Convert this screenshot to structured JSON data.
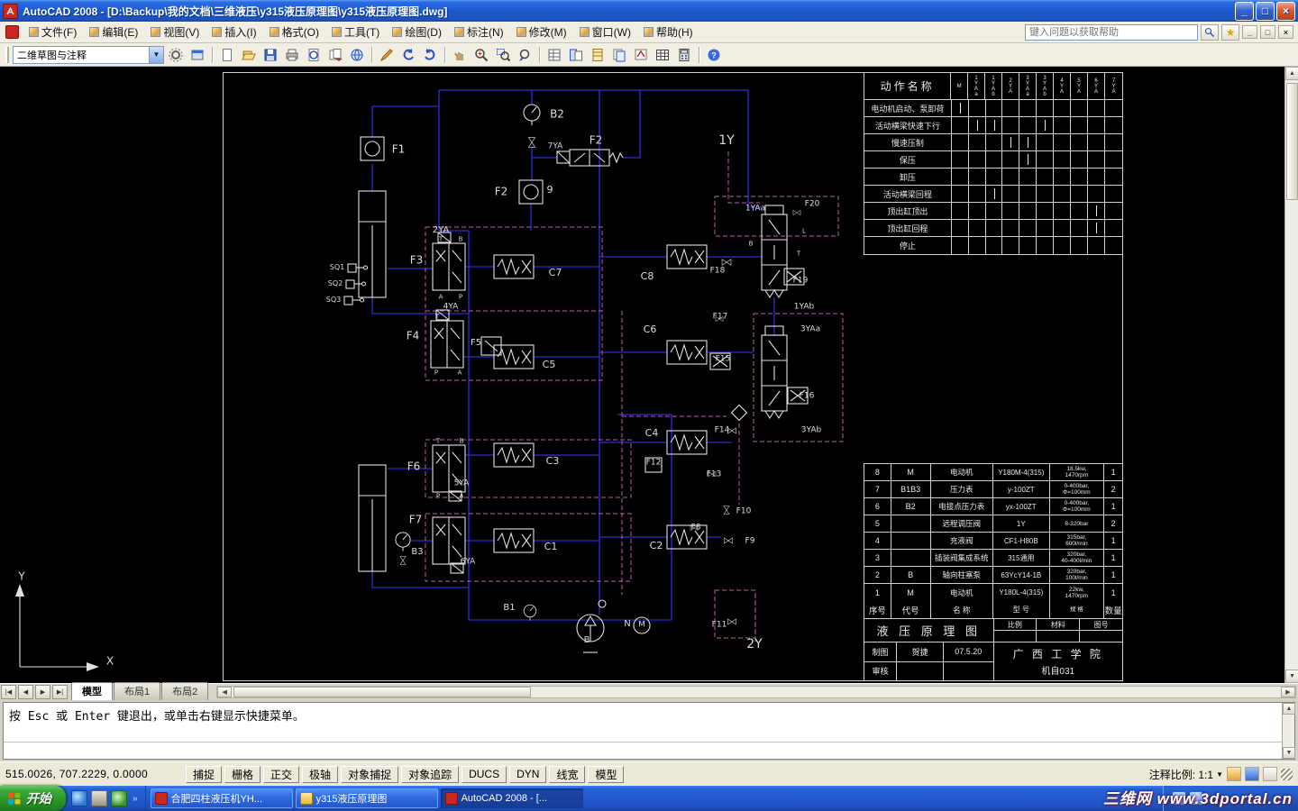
{
  "window": {
    "title": "AutoCAD 2008 - [D:\\Backup\\我的文档\\三维液压\\y315液压原理图\\y315液压原理图.dwg]"
  },
  "menu": {
    "items": [
      "文件(F)",
      "编辑(E)",
      "视图(V)",
      "插入(I)",
      "格式(O)",
      "工具(T)",
      "绘图(D)",
      "标注(N)",
      "修改(M)",
      "窗口(W)",
      "帮助(H)"
    ],
    "help_placeholder": "键入问题以获取帮助"
  },
  "toolbar": {
    "workspace": "二维草图与注释"
  },
  "command": {
    "message": "按 Esc 或 Enter 键退出，或单击右键显示快捷菜单。"
  },
  "status": {
    "coords": "515.0026, 707.2229, 0.0000",
    "toggles": [
      "捕捉",
      "栅格",
      "正交",
      "极轴",
      "对象捕捉",
      "对象追踪",
      "DUCS",
      "DYN",
      "线宽",
      "模型"
    ],
    "annotation_scale": "注释比例: 1:1"
  },
  "tabs": {
    "items": [
      "模型",
      "布局1",
      "布局2"
    ],
    "active": 0
  },
  "taskbar": {
    "start": "开始",
    "tasks": [
      {
        "label": "合肥四柱液压机YH...",
        "icon": "acad",
        "active": false
      },
      {
        "label": "y315液压原理图",
        "icon": "folder",
        "active": false
      },
      {
        "label": "AutoCAD 2008 - [...",
        "icon": "acad",
        "active": true
      }
    ],
    "watermark": "三维网 www.3dportal.cn"
  },
  "action_table": {
    "title": "动作名称",
    "motor_col": "M",
    "solenoid_cols": [
      "1YAa",
      "1YAb",
      "2YA",
      "3YAa",
      "3YAb",
      "4YA",
      "5YA",
      "6YA",
      "7YA"
    ],
    "rows": [
      "电动机启动、泵卸荷",
      "活动横梁快速下行",
      "慢速压制",
      "保压",
      "卸压",
      "活动横梁回程",
      "顶出缸顶出",
      "顶出缸回程",
      "停止"
    ],
    "marks": [
      [
        0,
        0
      ],
      [
        1,
        1
      ],
      [
        1,
        2
      ],
      [
        1,
        5
      ],
      [
        2,
        3
      ],
      [
        2,
        4
      ],
      [
        3,
        4
      ],
      [
        5,
        2
      ],
      [
        6,
        8
      ],
      [
        7,
        8
      ]
    ]
  },
  "bom": {
    "headers": [
      "序号",
      "代号",
      "名 称",
      "型 号",
      "规 格",
      "数量"
    ],
    "items": [
      {
        "seq": "8",
        "code": "M",
        "name": "电动机",
        "model": "Y180M-4(315)",
        "spec": "18.5kw,\n1470rpm",
        "qty": "1"
      },
      {
        "seq": "7",
        "code": "B1B3",
        "name": "压力表",
        "model": "y-100ZT",
        "spec": "0-400bar,\nΦ=100mm",
        "qty": "2"
      },
      {
        "seq": "6",
        "code": "B2",
        "name": "电接点压力表",
        "model": "yx-100ZT",
        "spec": "0-400bar,\nΦ=100mm",
        "qty": "1"
      },
      {
        "seq": "5",
        "code": "",
        "name": "远程调压阀",
        "model": "1Y",
        "spec": "8-320bar",
        "qty": "2"
      },
      {
        "seq": "4",
        "code": "",
        "name": "充液阀",
        "model": "CF1-H80B",
        "spec": "315bar,\n600l/min",
        "qty": "1"
      },
      {
        "seq": "3",
        "code": "",
        "name": "插装阀集成系统",
        "model": "315通用",
        "spec": "320bar,\n40-400l/min",
        "qty": "1"
      },
      {
        "seq": "2",
        "code": "B",
        "name": "轴向柱塞泵",
        "model": "63YcY14-1B",
        "spec": "320bar,\n100l/min",
        "qty": "1"
      },
      {
        "seq": "1",
        "code": "M",
        "name": "电动机",
        "model": "Y180L-4(315)",
        "spec": "22kw,\n1470rpm",
        "qty": "1"
      }
    ],
    "title": "液 压 原 理 图",
    "scale_label": "比例",
    "material_label": "材料",
    "figno_label": "图号",
    "drawn_label": "制图",
    "drawn_by": "贺捷",
    "date": "07.5.20",
    "org": "广 西 工 学 院",
    "checked_label": "审核",
    "class_no": "机自031"
  },
  "drawing": {
    "colors": {
      "main_lines": "#2e2ed6",
      "symbol_lines": "#e0e0e0",
      "pilot_lines": "#c05db0",
      "frame_lines": "#cccccc"
    },
    "labels": [
      [
        "B2",
        618,
        127,
        12
      ],
      [
        "F2",
        661,
        156,
        12
      ],
      [
        "7YA",
        616,
        163,
        9
      ],
      [
        "F1",
        442,
        166,
        12
      ],
      [
        "F2",
        556,
        213,
        12
      ],
      [
        "9",
        610,
        211,
        11
      ],
      [
        "1Y",
        806,
        157,
        14
      ],
      [
        "2YA",
        489,
        256,
        10
      ],
      [
        "F3",
        462,
        289,
        12
      ],
      [
        "SQ1",
        374,
        297,
        8
      ],
      [
        "SQ2",
        372,
        315,
        8
      ],
      [
        "SQ3",
        370,
        333,
        8
      ],
      [
        "C7",
        616,
        303,
        11
      ],
      [
        "C8",
        718,
        307,
        11
      ],
      [
        "F18",
        796,
        301,
        9
      ],
      [
        "F19",
        888,
        312,
        9
      ],
      [
        "F20",
        901,
        227,
        9
      ],
      [
        "1YAa",
        838,
        232,
        9
      ],
      [
        "1YAb",
        892,
        341,
        9
      ],
      [
        "4YA",
        500,
        341,
        9
      ],
      [
        "F4",
        458,
        373,
        12
      ],
      [
        "F5",
        528,
        381,
        10
      ],
      [
        "C5",
        609,
        405,
        11
      ],
      [
        "C6",
        721,
        366,
        11
      ],
      [
        "F17",
        799,
        352,
        9
      ],
      [
        "3YAa",
        899,
        366,
        9
      ],
      [
        "F15",
        802,
        399,
        9
      ],
      [
        "F16",
        895,
        440,
        9
      ],
      [
        "3YAb",
        900,
        478,
        9
      ],
      [
        "C4",
        723,
        481,
        11
      ],
      [
        "F14",
        801,
        478,
        9
      ],
      [
        "F6",
        459,
        518,
        12
      ],
      [
        "C3",
        613,
        512,
        11
      ],
      [
        "5YA",
        512,
        537,
        9
      ],
      [
        "F12",
        725,
        514,
        9
      ],
      [
        "F13",
        792,
        527,
        9
      ],
      [
        "F10",
        825,
        568,
        9
      ],
      [
        "F7",
        461,
        577,
        12
      ],
      [
        "B3",
        463,
        613,
        10
      ],
      [
        "6YA",
        519,
        624,
        9
      ],
      [
        "C1",
        611,
        607,
        11
      ],
      [
        "C2",
        728,
        606,
        11
      ],
      [
        "F9",
        832,
        601,
        9
      ],
      [
        "F8",
        772,
        586,
        9
      ],
      [
        "B1",
        565,
        675,
        10
      ],
      [
        "N",
        696,
        693,
        10
      ],
      [
        "M",
        712,
        694,
        9
      ],
      [
        "B",
        651,
        711,
        10
      ],
      [
        "F11",
        798,
        694,
        9
      ],
      [
        "2Y",
        837,
        716,
        14
      ],
      [
        "Y",
        24,
        640,
        12
      ],
      [
        "X",
        122,
        734,
        12
      ],
      [
        "T",
        489,
        266,
        7
      ],
      [
        "B",
        511,
        266,
        7
      ],
      [
        "A",
        489,
        330,
        7
      ],
      [
        "P",
        511,
        330,
        7
      ],
      [
        "T",
        485,
        352,
        7
      ],
      [
        "P",
        484,
        414,
        7
      ],
      [
        "A",
        510,
        414,
        7
      ],
      [
        "T",
        486,
        490,
        7
      ],
      [
        "B",
        512,
        490,
        7
      ],
      [
        "P",
        486,
        551,
        7
      ],
      [
        "A",
        512,
        551,
        7
      ],
      [
        "B",
        833,
        271,
        7
      ],
      [
        "T",
        886,
        282,
        7
      ],
      [
        "L",
        892,
        257,
        7
      ]
    ]
  }
}
